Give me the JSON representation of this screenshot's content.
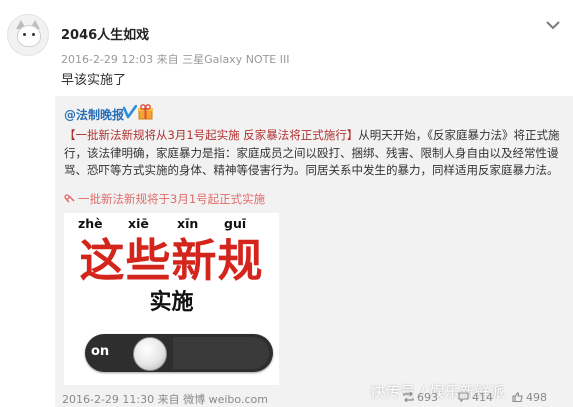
{
  "post": {
    "user_name": "2046人生如戏",
    "meta": "2016-2-29 12:03 来自 三星Galaxy NOTE III",
    "text": "早该实施了"
  },
  "repost": {
    "author": "@法制晚报",
    "text_bracket": "【一批新法新规将从3月1号起实施 反家暴法将正式施行】",
    "text_body": "从明天开始，《反家庭暴力法》将正式施行，该法律明确，家庭暴力是指：家庭成员之间以殴打、捆绑、残害、限制人身自由以及经常性谩骂、恐吓等方式实施的身体、精神等侵害行为。同居关系中发生的暴力，同样适用反家庭暴力法。",
    "link_text": "一批新法新规将于3月1号起正式实施",
    "image": {
      "pinyin": [
        "zhè",
        "xiē",
        "xīn",
        "guī"
      ],
      "title": "这些新规",
      "subtitle": "实施",
      "toggle_label": "on"
    },
    "footer_meta": "2016-2-29 11:30 来自 微博 weibo.com",
    "stats": {
      "reposts": "693",
      "comments": "414",
      "likes": "498"
    }
  },
  "watermark": "快传号 / 娱乐新鲜派",
  "colors": {
    "link": "#2a6fb5",
    "headline_red": "#d4251d",
    "repost_bg": "#f2f2f2"
  }
}
